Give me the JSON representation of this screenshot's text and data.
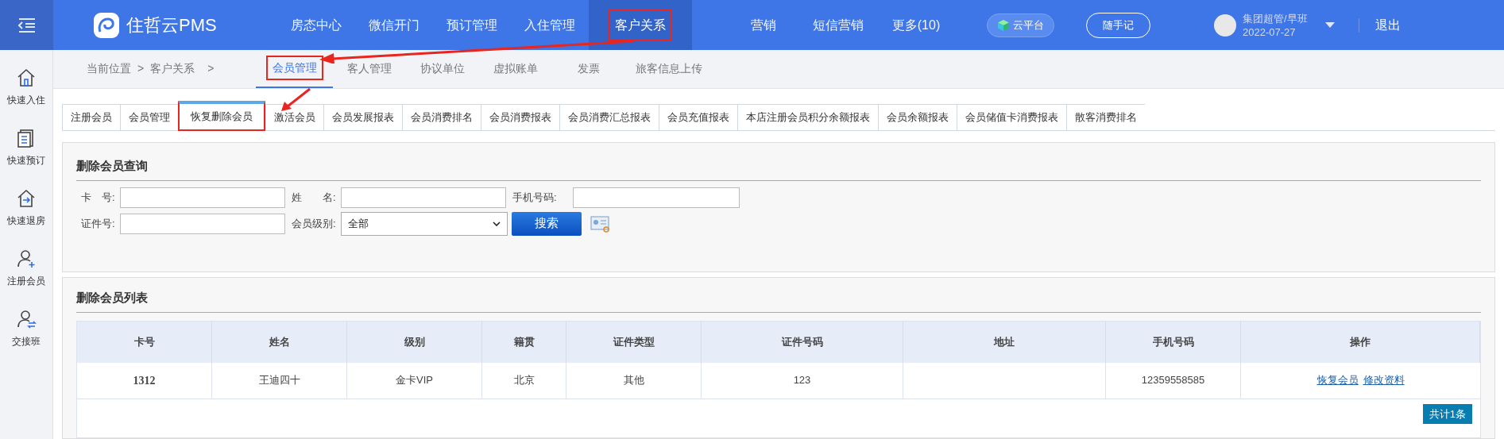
{
  "header": {
    "logo": "住哲云PMS",
    "nav": [
      {
        "label": "房态中心",
        "selected": false,
        "highlighted": false
      },
      {
        "label": "微信开门",
        "selected": false,
        "highlighted": false
      },
      {
        "label": "预订管理",
        "selected": false,
        "highlighted": false
      },
      {
        "label": "入住管理",
        "selected": false,
        "highlighted": false
      },
      {
        "label": "客户关系",
        "selected": true,
        "highlighted": true
      },
      {
        "label": "营销",
        "selected": false,
        "highlighted": false
      },
      {
        "label": "短信营销",
        "selected": false,
        "highlighted": false
      },
      {
        "label": "更多(10)",
        "selected": false,
        "highlighted": false
      }
    ],
    "cloud_button": "云平台",
    "notes_button": "随手记",
    "user": {
      "name": "集团超管/早班",
      "date": "2022-07-27"
    },
    "logout": "退出"
  },
  "sidebar": [
    {
      "label": "快速入住",
      "kind": "home"
    },
    {
      "label": "快速预订",
      "kind": "list"
    },
    {
      "label": "快速退房",
      "kind": "checkout"
    },
    {
      "label": "注册会员",
      "kind": "adduser"
    },
    {
      "label": "交接班",
      "kind": "swapuser"
    }
  ],
  "breadcrumb": {
    "label": "当前位置",
    "sep1": ">",
    "section": "客户关系",
    "sep2": ">"
  },
  "subnav": [
    {
      "label": "会员管理",
      "selected": true,
      "highlighted": true
    },
    {
      "label": "客人管理",
      "selected": false,
      "highlighted": false
    },
    {
      "label": "协议单位",
      "selected": false,
      "highlighted": false
    },
    {
      "label": "虚拟账单",
      "selected": false,
      "highlighted": false
    },
    {
      "label": "发票",
      "selected": false,
      "highlighted": false
    },
    {
      "label": "旅客信息上传",
      "selected": false,
      "highlighted": false
    }
  ],
  "tabs": [
    {
      "label": "注册会员",
      "selected": false,
      "highlighted": false
    },
    {
      "label": "会员管理",
      "selected": false,
      "highlighted": false
    },
    {
      "label": "恢复删除会员",
      "selected": true,
      "highlighted": true
    },
    {
      "label": "激活会员",
      "selected": false,
      "highlighted": false
    },
    {
      "label": "会员发展报表",
      "selected": false,
      "highlighted": false
    },
    {
      "label": "会员消费排名",
      "selected": false,
      "highlighted": false
    },
    {
      "label": "会员消费报表",
      "selected": false,
      "highlighted": false
    },
    {
      "label": "会员消费汇总报表",
      "selected": false,
      "highlighted": false
    },
    {
      "label": "会员充值报表",
      "selected": false,
      "highlighted": false
    },
    {
      "label": "本店注册会员积分余额报表",
      "selected": false,
      "highlighted": false
    },
    {
      "label": "会员余额报表",
      "selected": false,
      "highlighted": false
    },
    {
      "label": "会员储值卡消费报表",
      "selected": false,
      "highlighted": false
    },
    {
      "label": "散客消费排名",
      "selected": false,
      "highlighted": false
    }
  ],
  "search_panel": {
    "title": "删除会员查询",
    "card_label": "卡　号:",
    "name_label": "姓　　名:",
    "phone_label": "手机号码:",
    "id_label": "证件号:",
    "level_label": "会员级别:",
    "level_value": "全部",
    "search_button": "搜索"
  },
  "list_panel": {
    "title": "删除会员列表",
    "table": {
      "columns": [
        "卡号",
        "姓名",
        "级别",
        "籍贯",
        "证件类型",
        "证件号码",
        "地址",
        "手机号码",
        "操作"
      ],
      "rows": [
        {
          "cells": [
            "1312",
            "王迪四十",
            "金卡VIP",
            "北京",
            "其他",
            "123",
            "",
            "12359558585"
          ],
          "actions": [
            "恢复会员",
            "修改资料"
          ]
        }
      ]
    },
    "total": "共计1条"
  }
}
